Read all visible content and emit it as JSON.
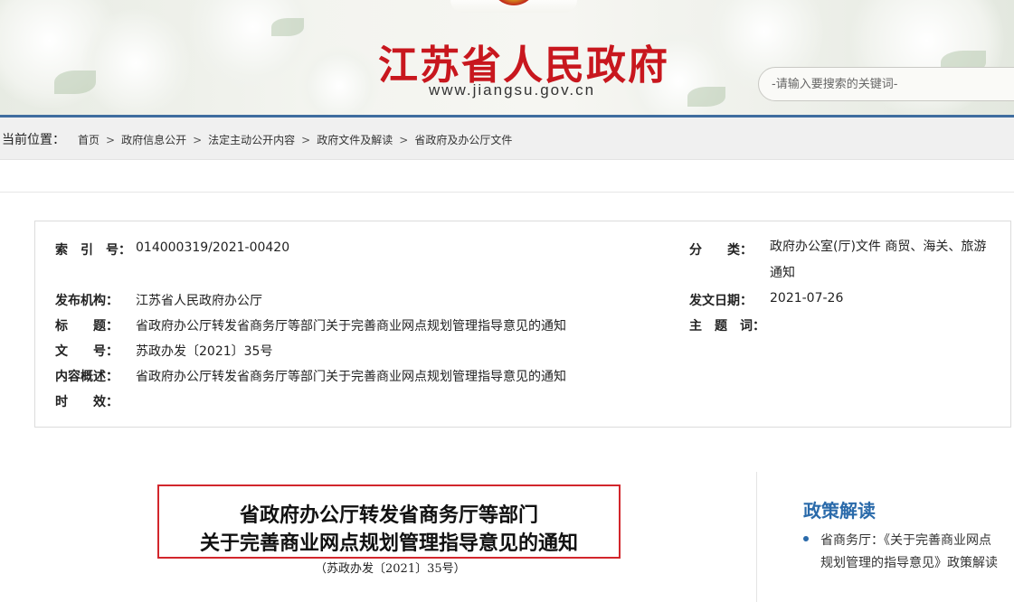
{
  "header": {
    "site_title": "江苏省人民政府",
    "site_url": "www.jiangsu.gov.cn",
    "search_placeholder": "-请输入要搜索的关键词-",
    "accent_color": "#c8171e",
    "bar_color": "#3f6d9f"
  },
  "breadcrumb": {
    "label": "当前位置：",
    "items": [
      "首页",
      "政府信息公开",
      "法定主动公开内容",
      "政府文件及解读",
      "省政府及办公厅文件"
    ],
    "separator": ">"
  },
  "meta": {
    "index_label": "索　引　号：",
    "index_value": "014000319/2021-00420",
    "category_label": "分　　类：",
    "category_value": "政府办公室(厅)文件 商贸、海关、旅游 通知",
    "publisher_label": "发布机构：",
    "publisher_value": "江苏省人民政府办公厅",
    "date_label": "发文日期：",
    "date_value": "2021-07-26",
    "title_label": "标　　题：",
    "title_value": "省政府办公厅转发省商务厅等部门关于完善商业网点规划管理指导意见的通知",
    "subject_label": "主　题　词：",
    "subject_value": "",
    "doc_no_label": "文　　号：",
    "doc_no_value": "苏政办发〔2021〕35号",
    "summary_label": "内容概述：",
    "summary_value": "省政府办公厅转发省商务厅等部门关于完善商业网点规划管理指导意见的通知",
    "validity_label": "时　　效：",
    "validity_value": ""
  },
  "document": {
    "title_line1": "省政府办公厅转发省商务厅等部门",
    "title_line2": "关于完善商业网点规划管理指导意见的通知",
    "number": "（苏政办发〔2021〕35号）",
    "frame_color": "#d2262c"
  },
  "sidebar": {
    "heading": "政策解读",
    "items": [
      "省商务厅：《关于完善商业网点规划管理的指导意见》政策解读"
    ],
    "accent_color": "#2a6aaa"
  }
}
